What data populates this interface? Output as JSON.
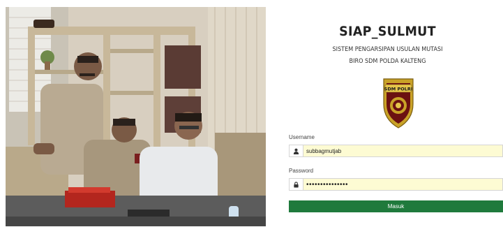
{
  "app": {
    "title": "SIAP_SULMUT",
    "subtitle_line1": "SISTEM PENGARSIPAN USULAN MUTASI",
    "subtitle_line2": "BIRO SDM POLDA KALTENG"
  },
  "logo": {
    "text": "SDM POLRI",
    "colors": {
      "shield": "#c9a227",
      "inner": "#6b1111",
      "ribbon": "#e5c54a"
    }
  },
  "form": {
    "username_label": "Username",
    "username_value": "subbagmutjab",
    "username_icon": "user-icon",
    "password_label": "Password",
    "password_value": "•••••••••••••••",
    "password_icon": "lock-icon",
    "submit_label": "Masuk"
  },
  "colors": {
    "submit_bg": "#1f7a3c",
    "input_bg": "#fdfbd3"
  }
}
